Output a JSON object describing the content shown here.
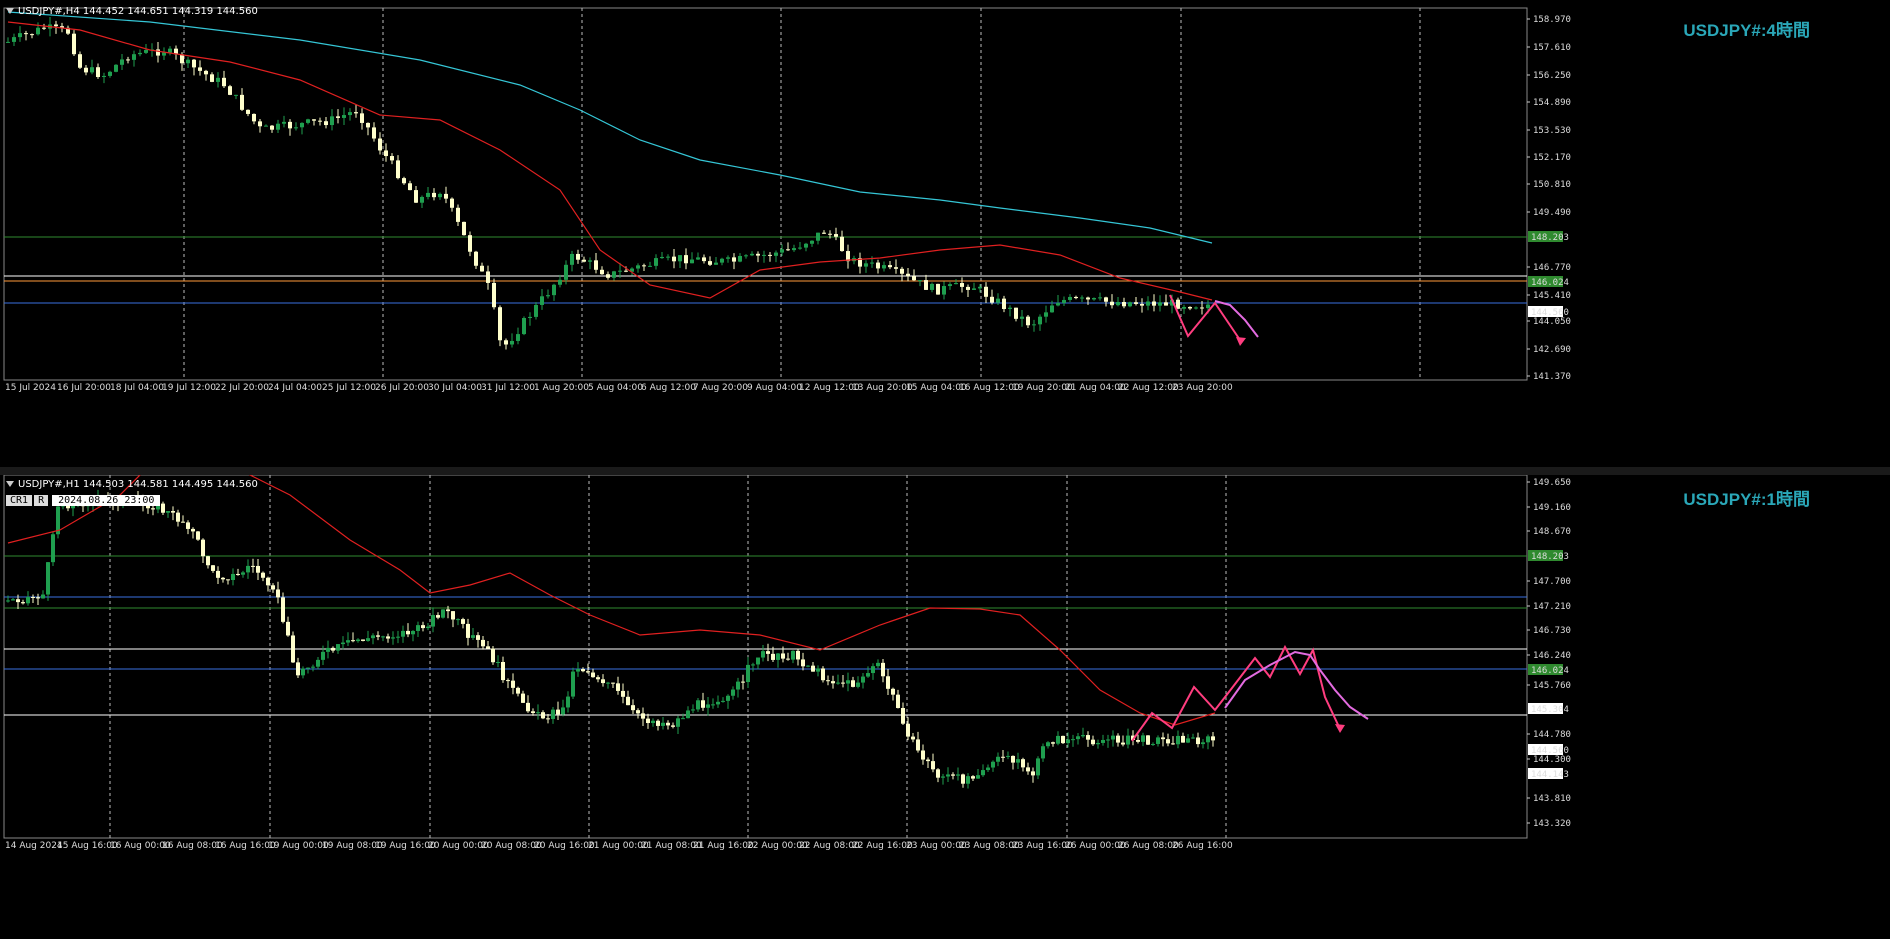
{
  "top": {
    "header": "USDJPY#,H4  144.452 144.651 144.319 144.560",
    "label": "USDJPY#:4時間",
    "price_labels": [
      "158.970",
      "157.610",
      "156.250",
      "154.890",
      "153.530",
      "152.170",
      "150.810",
      "149.490",
      "148.203",
      "146.770",
      "146.024",
      "145.410",
      "144.560",
      "144.050",
      "142.690",
      "141.370"
    ],
    "time_labels": [
      "15 Jul 2024",
      "16 Jul 20:00",
      "18 Jul 04:00",
      "19 Jul 12:00",
      "22 Jul 20:00",
      "24 Jul 04:00",
      "25 Jul 12:00",
      "26 Jul 20:00",
      "30 Jul 04:00",
      "31 Jul 12:00",
      "1 Aug 20:00",
      "5 Aug 04:00",
      "6 Aug 12:00",
      "7 Aug 20:00",
      "9 Aug 04:00",
      "12 Aug 12:00",
      "13 Aug 20:00",
      "15 Aug 04:00",
      "16 Aug 12:00",
      "19 Aug 20:00",
      "21 Aug 04:00",
      "22 Aug 12:00",
      "23 Aug 20:00"
    ],
    "level_labels": {
      "green_high": "148.203",
      "green_low": "146.024",
      "current": "144.560"
    }
  },
  "bottom": {
    "header": "USDJPY#,H1  144.503 144.581 144.495 144.560",
    "label": "USDJPY#:1時間",
    "cr_buttons": [
      "CR1",
      "R"
    ],
    "crosshair_time": "2024.08.26 23:00",
    "price_labels": [
      "149.650",
      "149.160",
      "148.670",
      "148.203",
      "147.700",
      "147.210",
      "146.730",
      "146.240",
      "146.024",
      "145.760",
      "145.304",
      "144.780",
      "144.560",
      "144.300",
      "144.143",
      "143.810",
      "143.320"
    ],
    "time_labels": [
      "14 Aug 2024",
      "15 Aug 16:00",
      "16 Aug 00:00",
      "16 Aug 08:00",
      "16 Aug 16:00",
      "19 Aug 00:00",
      "19 Aug 08:00",
      "19 Aug 16:00",
      "20 Aug 00:00",
      "20 Aug 08:00",
      "20 Aug 16:00",
      "21 Aug 00:00",
      "21 Aug 08:00",
      "21 Aug 16:00",
      "22 Aug 00:00",
      "22 Aug 08:00",
      "22 Aug 16:00",
      "23 Aug 00:00",
      "23 Aug 08:00",
      "23 Aug 16:00",
      "26 Aug 00:00",
      "26 Aug 08:00",
      "26 Aug 16:00"
    ],
    "level_labels": {
      "green_high": "148.203",
      "green_low": "146.024",
      "white_high": "145.304",
      "current": "144.560",
      "white_low": "144.143"
    }
  },
  "colors": {
    "bull": "#1f9f4f",
    "bear": "#ffffcc",
    "ma_red": "#e02020",
    "ma_cyan": "#35c6d6",
    "green_line": "#2f8a2f",
    "blue_line": "#3a6fe0",
    "pink": "#ff3d7f",
    "violet": "#e36be0",
    "label": "#2aa7b8"
  }
}
